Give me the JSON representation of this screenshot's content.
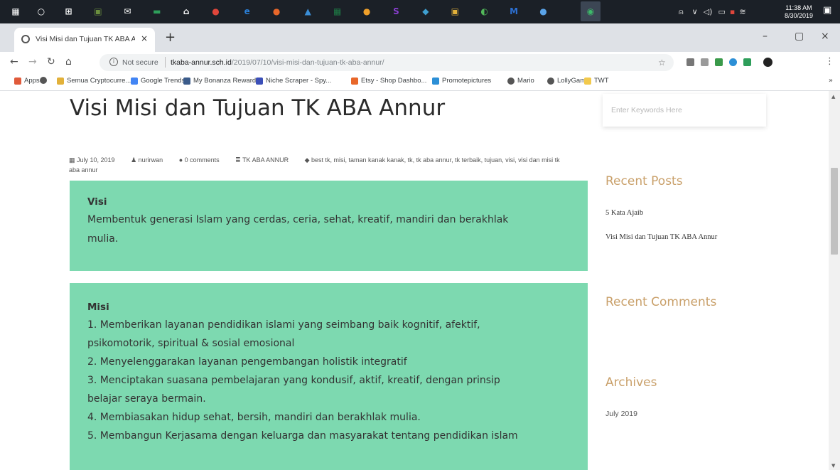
{
  "taskbar": {
    "apps": [
      {
        "name": "start-icon",
        "glyph": "▦",
        "color": "#ffffff"
      },
      {
        "name": "cortana-icon",
        "glyph": "○",
        "color": "#ffffff"
      },
      {
        "name": "task-view-icon",
        "glyph": "⊞",
        "color": "#ffffff"
      },
      {
        "name": "app-game-icon",
        "glyph": "▣",
        "color": "#6b8f3f"
      },
      {
        "name": "mail-icon",
        "glyph": "✉",
        "color": "#ffffff"
      },
      {
        "name": "app-green-icon",
        "glyph": "▬",
        "color": "#2e9e5a"
      },
      {
        "name": "store-icon",
        "glyph": "⌂",
        "color": "#ffffff"
      },
      {
        "name": "app-red-icon",
        "glyph": "●",
        "color": "#e0463b"
      },
      {
        "name": "edge-icon",
        "glyph": "e",
        "color": "#2b7fd6"
      },
      {
        "name": "firefox-icon",
        "glyph": "●",
        "color": "#e8672a"
      },
      {
        "name": "app-blue-icon",
        "glyph": "▲",
        "color": "#3b8ed6"
      },
      {
        "name": "excel-icon",
        "glyph": "▦",
        "color": "#1e7a45"
      },
      {
        "name": "app-orange-icon",
        "glyph": "●",
        "color": "#f0a02a"
      },
      {
        "name": "app-purple-icon",
        "glyph": "S",
        "color": "#8a3fd1"
      },
      {
        "name": "app-teal-icon",
        "glyph": "◆",
        "color": "#3fa0d1"
      },
      {
        "name": "app-yellow-icon",
        "glyph": "▣",
        "color": "#e2b13a"
      },
      {
        "name": "app-green2-icon",
        "glyph": "◐",
        "color": "#52b85a"
      },
      {
        "name": "app-blue2-icon",
        "glyph": "M",
        "color": "#2c6fd1"
      },
      {
        "name": "app-chat-icon",
        "glyph": "●",
        "color": "#5aa3e8"
      },
      {
        "name": "chrome-taskbar-icon",
        "glyph": "◉",
        "color": "#3dba6a"
      }
    ],
    "clock_time": "11:38 AM",
    "clock_date": "8/30/2019"
  },
  "browser": {
    "tab_title": "Visi Misi dan Tujuan TK ABA Ann",
    "security_label": "Not secure",
    "url_domain": "tkaba-annur.sch.id",
    "url_path": "/2019/07/10/visi-misi-dan-tujuan-tk-aba-annur/",
    "bookmarks": [
      {
        "label": "Apps",
        "color": "#e05a3a"
      },
      {
        "label": "",
        "color": "#555555"
      },
      {
        "label": "Semua Cryptocurre...",
        "color": "#e2b13a"
      },
      {
        "label": "Google Trends",
        "color": "#4285f4"
      },
      {
        "label": "My Bonanza Rewards",
        "color": "#3b5b8a"
      },
      {
        "label": "Niche Scraper - Spy...",
        "color": "#3b4fb8"
      },
      {
        "label": "Etsy - Shop Dashbo...",
        "color": "#e8672a"
      },
      {
        "label": "Promotepictures",
        "color": "#2c8fd6"
      },
      {
        "label": "Mario",
        "color": "#555555"
      },
      {
        "label": "LollyGame",
        "color": "#555555"
      },
      {
        "label": "TWT",
        "color": "#f2c94c"
      }
    ]
  },
  "post": {
    "title": "Visi Misi dan Tujuan TK ABA Annur",
    "meta": {
      "date": "July 10, 2019",
      "author": "nurirwan",
      "comments": "0 comments",
      "category": "TK ABA ANNUR",
      "tags": "best tk, misi, taman kanak kanak, tk, tk aba annur, tk terbaik, tujuan, visi, visi dan misi tk aba annur"
    },
    "visi": {
      "heading": "Visi",
      "lines": [
        "Membentuk generasi Islam yang cerdas, ceria, sehat, kreatif, mandiri dan berakhlak",
        "mulia."
      ]
    },
    "misi": {
      "heading": "Misi",
      "lines": [
        "1. Memberikan layanan pendidikan islami yang seimbang baik kognitif, afektif,",
        "psikomotorik, spiritual & sosial emosional",
        "2. Menyelenggarakan layanan pengembangan holistik integratif",
        "3. Menciptakan suasana pembelajaran yang kondusif, aktif, kreatif, dengan prinsip",
        "belajar seraya bermain.",
        "4. Membiasakan hidup sehat, bersih, mandiri dan berakhlak mulia.",
        "5. Membangun Kerjasama dengan keluarga dan masyarakat tentang pendidikan islam"
      ]
    }
  },
  "sidebar": {
    "search_placeholder": "Enter Keywords Here",
    "recent_posts_title": "Recent Posts",
    "recent_posts": [
      "5 Kata Ajaib",
      "Visi Misi dan Tujuan TK ABA Annur"
    ],
    "recent_comments_title": "Recent Comments",
    "archives_title": "Archives",
    "archives": [
      "July 2019"
    ]
  },
  "colors": {
    "box_green": "#7dd9b0",
    "widget_title": "#c9a06a",
    "taskbar": "#1b2027"
  }
}
